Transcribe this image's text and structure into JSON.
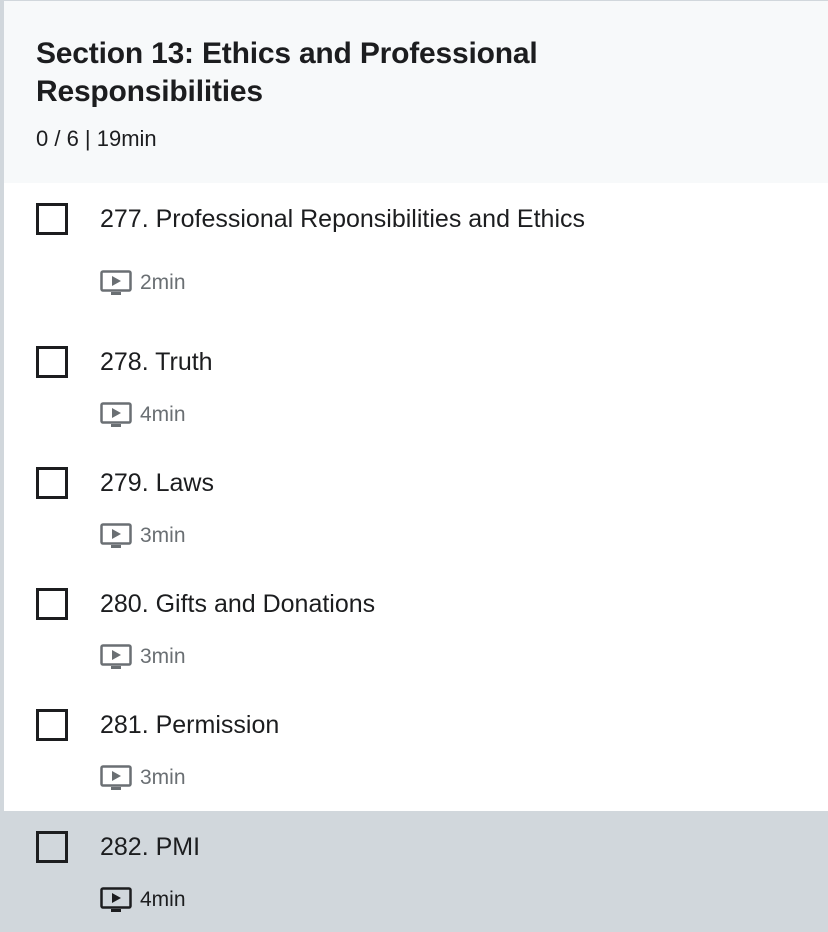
{
  "section": {
    "title": "Section 13: Ethics and Professional Responsibilities",
    "progress": "0 / 6 | 19min"
  },
  "lectures": [
    {
      "title": "277. Professional Reponsibilities and Ethics",
      "duration": "2min",
      "icon": "video-icon",
      "completed": false
    },
    {
      "title": "278. Truth",
      "duration": "4min",
      "icon": "video-icon",
      "completed": false
    },
    {
      "title": "279. Laws",
      "duration": "3min",
      "icon": "video-icon",
      "completed": false
    },
    {
      "title": "280. Gifts and Donations",
      "duration": "3min",
      "icon": "video-icon",
      "completed": false
    },
    {
      "title": "281. Permission",
      "duration": "3min",
      "icon": "video-icon",
      "completed": false
    },
    {
      "title": "282. PMI",
      "duration": "4min",
      "icon": "video-icon",
      "completed": false,
      "current": true
    }
  ],
  "colors": {
    "header_bg": "#f7f9fa",
    "active_bg": "#d1d7dc",
    "text": "#1c1d1f",
    "muted": "#6a6f73"
  }
}
